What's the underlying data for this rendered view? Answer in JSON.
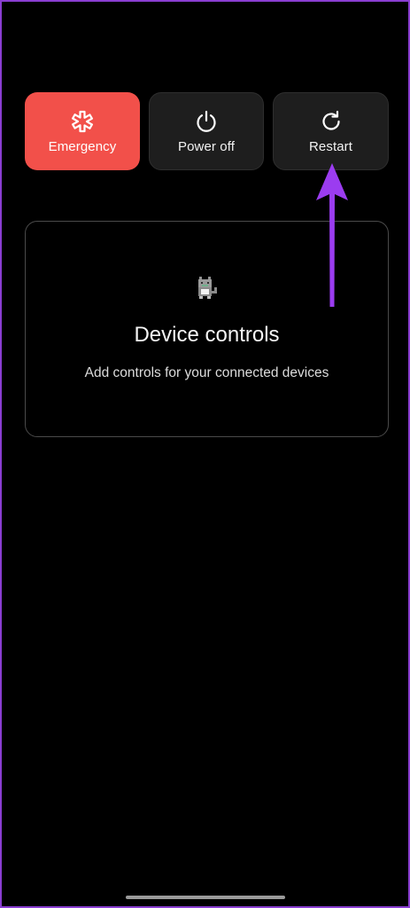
{
  "power_menu": {
    "emergency": {
      "label": "Emergency",
      "icon": "medical-star-icon",
      "color": "#f2504a"
    },
    "power_off": {
      "label": "Power off",
      "icon": "power-icon"
    },
    "restart": {
      "label": "Restart",
      "icon": "restart-icon"
    }
  },
  "device_controls": {
    "icon": "cat-icon",
    "title": "Device controls",
    "subtitle": "Add controls for your connected devices"
  },
  "annotation": {
    "icon": "arrow-up-icon",
    "color": "#9b3cf0"
  },
  "colors": {
    "background": "#000000",
    "frame_border": "#8a3ed1",
    "button_dark": "#1e1e1e"
  }
}
